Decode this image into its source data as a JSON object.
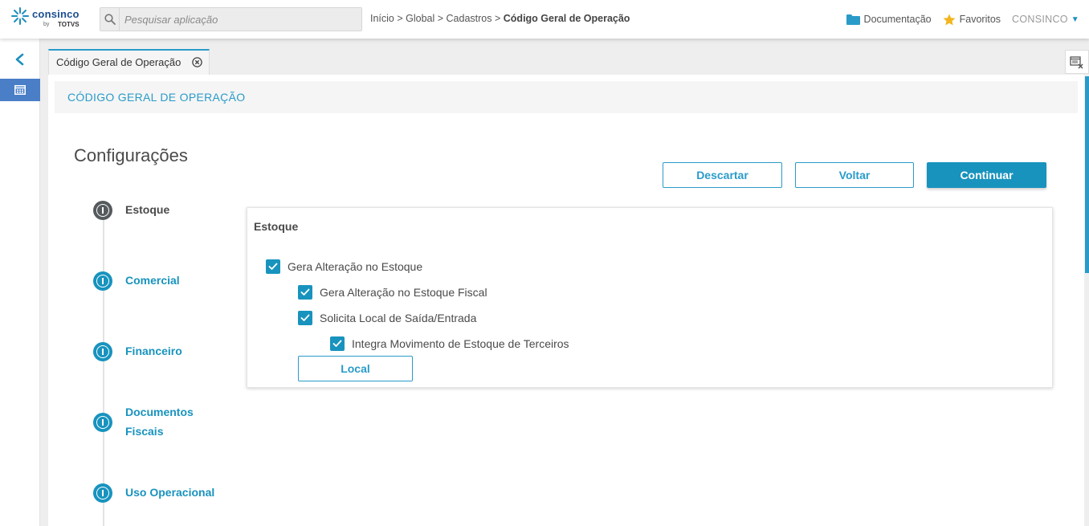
{
  "header": {
    "brand": "consinco",
    "brand_by": "by",
    "brand_parent": "TOTVS",
    "search_placeholder": "Pesquisar aplicação",
    "breadcrumb": {
      "parts": [
        "Início",
        "Global",
        "Cadastros"
      ],
      "separator": " > ",
      "current": "Código Geral de Operação"
    },
    "documentation_label": "Documentação",
    "favorites_label": "Favoritos",
    "user_label": "CONSINCO"
  },
  "tabs": [
    {
      "label": "Código Geral de Operação"
    }
  ],
  "page": {
    "header_title": "CÓDIGO GERAL DE OPERAÇÃO",
    "config_title": "Configurações"
  },
  "actions": {
    "discard_label": "Descartar",
    "back_label": "Voltar",
    "continue_label": "Continuar"
  },
  "steps": [
    {
      "label": "Estoque",
      "active": true
    },
    {
      "label": "Comercial",
      "active": false
    },
    {
      "label": "Financeiro",
      "active": false
    },
    {
      "label": "Documentos Fiscais",
      "active": false
    },
    {
      "label": "Uso Operacional",
      "active": false
    }
  ],
  "card": {
    "title": "Estoque",
    "checkboxes": [
      {
        "label": "Gera Alteração no Estoque",
        "checked": true
      },
      {
        "label": "Gera Alteração no Estoque Fiscal",
        "checked": true
      },
      {
        "label": "Solicita Local de Saída/Entrada",
        "checked": true
      },
      {
        "label": "Integra Movimento de Estoque de Terceiros",
        "checked": true
      }
    ],
    "local_button_label": "Local"
  },
  "colors": {
    "accent": "#1893be",
    "active_step": "#555a5e",
    "sidebar_active": "#4a7fc7",
    "favorites_star": "#f2b51c",
    "folder": "#2a9bc9"
  }
}
